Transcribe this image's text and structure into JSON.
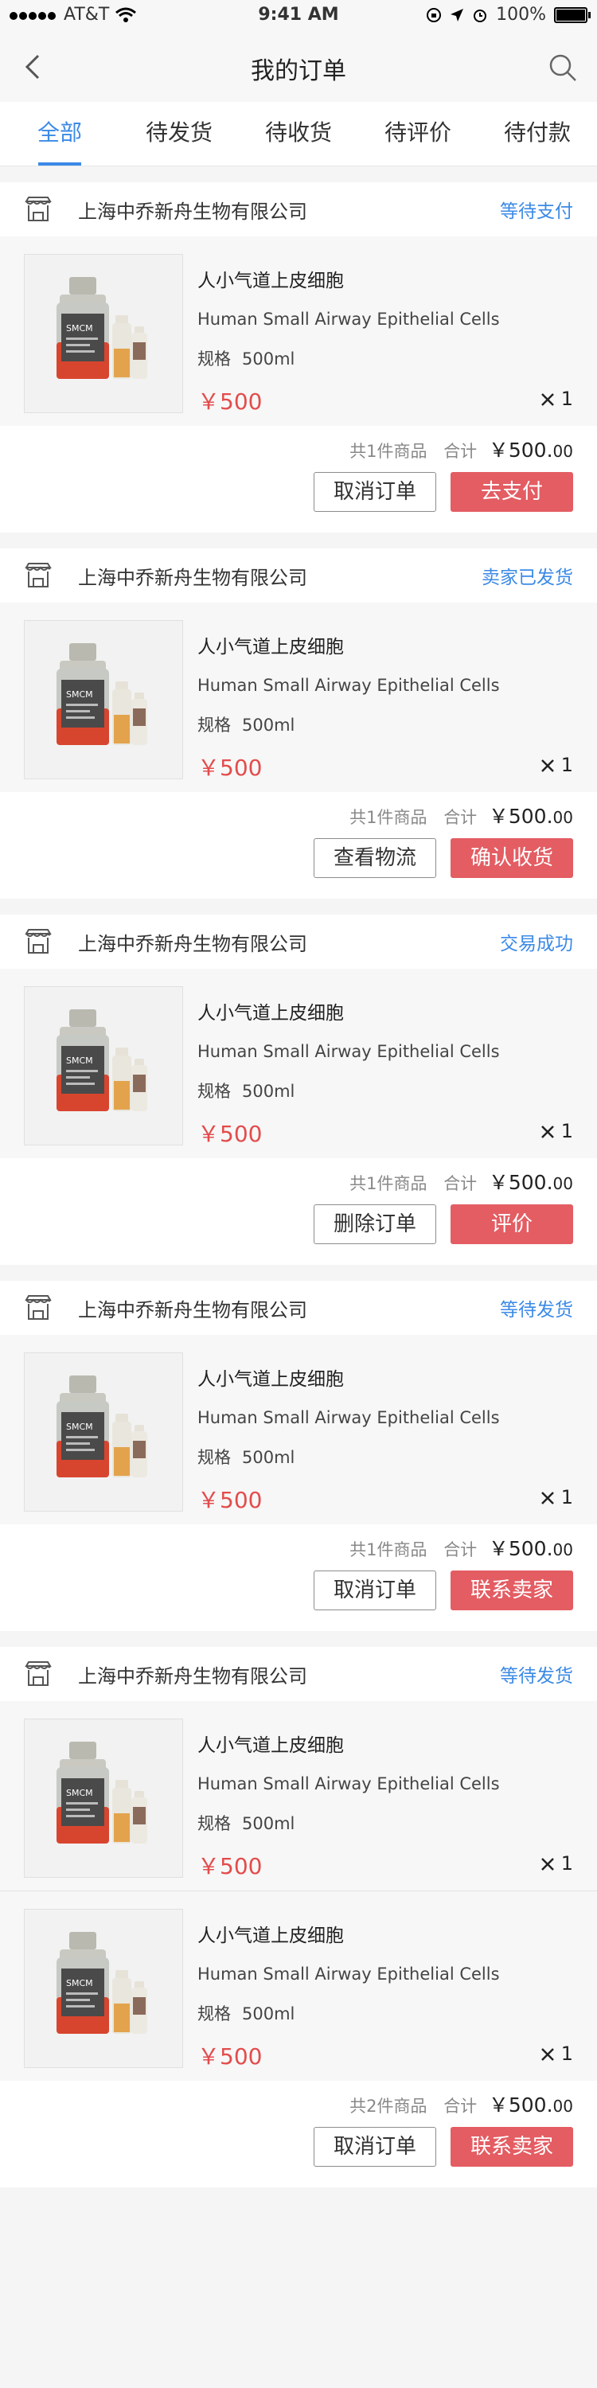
{
  "status_bar": {
    "carrier": "AT&T",
    "time": "9:41 AM",
    "battery": "100%"
  },
  "header": {
    "title": "我的订单"
  },
  "tabs": [
    {
      "label": "全部",
      "active": true
    },
    {
      "label": "待发货",
      "active": false
    },
    {
      "label": "待收货",
      "active": false
    },
    {
      "label": "待评价",
      "active": false
    },
    {
      "label": "待付款",
      "active": false
    }
  ],
  "colors": {
    "accent": "#3b8ae6",
    "price": "#e34c4c",
    "primary_button": "#e35d63"
  },
  "orders": [
    {
      "shop": "上海中乔新舟生物有限公司",
      "status": "等待支付",
      "products": [
        {
          "name": "人小气道上皮细胞",
          "name_en": "Human Small Airway Epithelial Cells",
          "spec_label": "规格",
          "spec": "500ml",
          "price": "￥500",
          "qty": "1"
        }
      ],
      "count_text": "共1件商品",
      "total_label": "合计",
      "total": "￥500.",
      "total_cents": "00",
      "buttons": [
        "取消订单",
        "去支付"
      ]
    },
    {
      "shop": "上海中乔新舟生物有限公司",
      "status": "卖家已发货",
      "products": [
        {
          "name": "人小气道上皮细胞",
          "name_en": "Human Small Airway Epithelial Cells",
          "spec_label": "规格",
          "spec": "500ml",
          "price": "￥500",
          "qty": "1"
        }
      ],
      "count_text": "共1件商品",
      "total_label": "合计",
      "total": "￥500.",
      "total_cents": "00",
      "buttons": [
        "查看物流",
        "确认收货"
      ]
    },
    {
      "shop": "上海中乔新舟生物有限公司",
      "status": "交易成功",
      "products": [
        {
          "name": "人小气道上皮细胞",
          "name_en": "Human Small Airway Epithelial Cells",
          "spec_label": "规格",
          "spec": "500ml",
          "price": "￥500",
          "qty": "1"
        }
      ],
      "count_text": "共1件商品",
      "total_label": "合计",
      "total": "￥500.",
      "total_cents": "00",
      "buttons": [
        "删除订单",
        "评价"
      ]
    },
    {
      "shop": "上海中乔新舟生物有限公司",
      "status": "等待发货",
      "products": [
        {
          "name": "人小气道上皮细胞",
          "name_en": "Human Small Airway Epithelial Cells",
          "spec_label": "规格",
          "spec": "500ml",
          "price": "￥500",
          "qty": "1"
        }
      ],
      "count_text": "共1件商品",
      "total_label": "合计",
      "total": "￥500.",
      "total_cents": "00",
      "buttons": [
        "取消订单",
        "联系卖家"
      ]
    },
    {
      "shop": "上海中乔新舟生物有限公司",
      "status": "等待发货",
      "products": [
        {
          "name": "人小气道上皮细胞",
          "name_en": "Human Small Airway Epithelial Cells",
          "spec_label": "规格",
          "spec": "500ml",
          "price": "￥500",
          "qty": "1"
        },
        {
          "name": "人小气道上皮细胞",
          "name_en": "Human Small Airway Epithelial Cells",
          "spec_label": "规格",
          "spec": "500ml",
          "price": "￥500",
          "qty": "1"
        }
      ],
      "count_text": "共2件商品",
      "total_label": "合计",
      "total": "￥500.",
      "total_cents": "00",
      "buttons": [
        "取消订单",
        "联系卖家"
      ]
    }
  ],
  "product_image": {
    "bottle_label": "SMCM"
  }
}
